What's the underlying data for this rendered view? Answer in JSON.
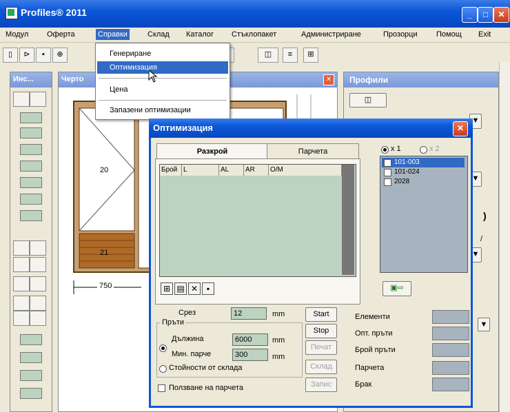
{
  "app": {
    "title": "Profiles® 2011"
  },
  "window_controls": {
    "minimize": "_",
    "maximize": "□",
    "close": "✕"
  },
  "menu": [
    "Модул",
    "Оферта",
    "Справки",
    "Склад",
    "Каталог",
    "Стъклопакет",
    "Администриране",
    "Прозорци",
    "Помощ",
    "Exit"
  ],
  "dropdown": {
    "items": [
      "Генериране",
      "Оптимизация",
      "Цена",
      "Запазени оптимизации"
    ],
    "selected": "Оптимизация"
  },
  "left_panel": {
    "title": "Инс..."
  },
  "draw_panel": {
    "title": "Черто",
    "close_icon": "✕",
    "labels": {
      "pane_top": "20",
      "pane_bottom": "21",
      "dimension": "750"
    }
  },
  "right_panel": {
    "title": "Профили",
    "side_chars": [
      ")",
      "/"
    ]
  },
  "dialog": {
    "title": "Оптимизация",
    "close": "✕",
    "tabs": [
      "Разкрой",
      "Парчета"
    ],
    "active_tab": "Разкрой",
    "columns": [
      "Брой",
      "L",
      "AL",
      "AR",
      "O/M"
    ],
    "radio_x1": "x 1",
    "radio_x2": "x 2",
    "profiles": [
      {
        "code": "101-003",
        "selected": true
      },
      {
        "code": "101-024",
        "selected": false
      },
      {
        "code": "2028",
        "selected": false
      }
    ],
    "icon_buttons": [
      "⊞",
      "▤",
      "✕",
      "▪"
    ],
    "export_arrow": "⇨",
    "srez_label": "Срез",
    "srez_value": "12",
    "unit_mm": "mm",
    "pruti_group": "Пръти",
    "length_label": "Дължина",
    "length_value": "6000",
    "min_piece_label": "Мин. парче",
    "min_piece_value": "300",
    "stock_label": "Стойности от склада",
    "use_pieces_label": "Ползване на парчета",
    "buttons": {
      "start": "Start",
      "stop": "Stop",
      "print": "Печат",
      "stock": "Склад",
      "save": "Запис"
    },
    "stats": [
      "Елементи",
      "Опт. пръти",
      "Брой пръти",
      "Парчета",
      "Брак"
    ]
  }
}
